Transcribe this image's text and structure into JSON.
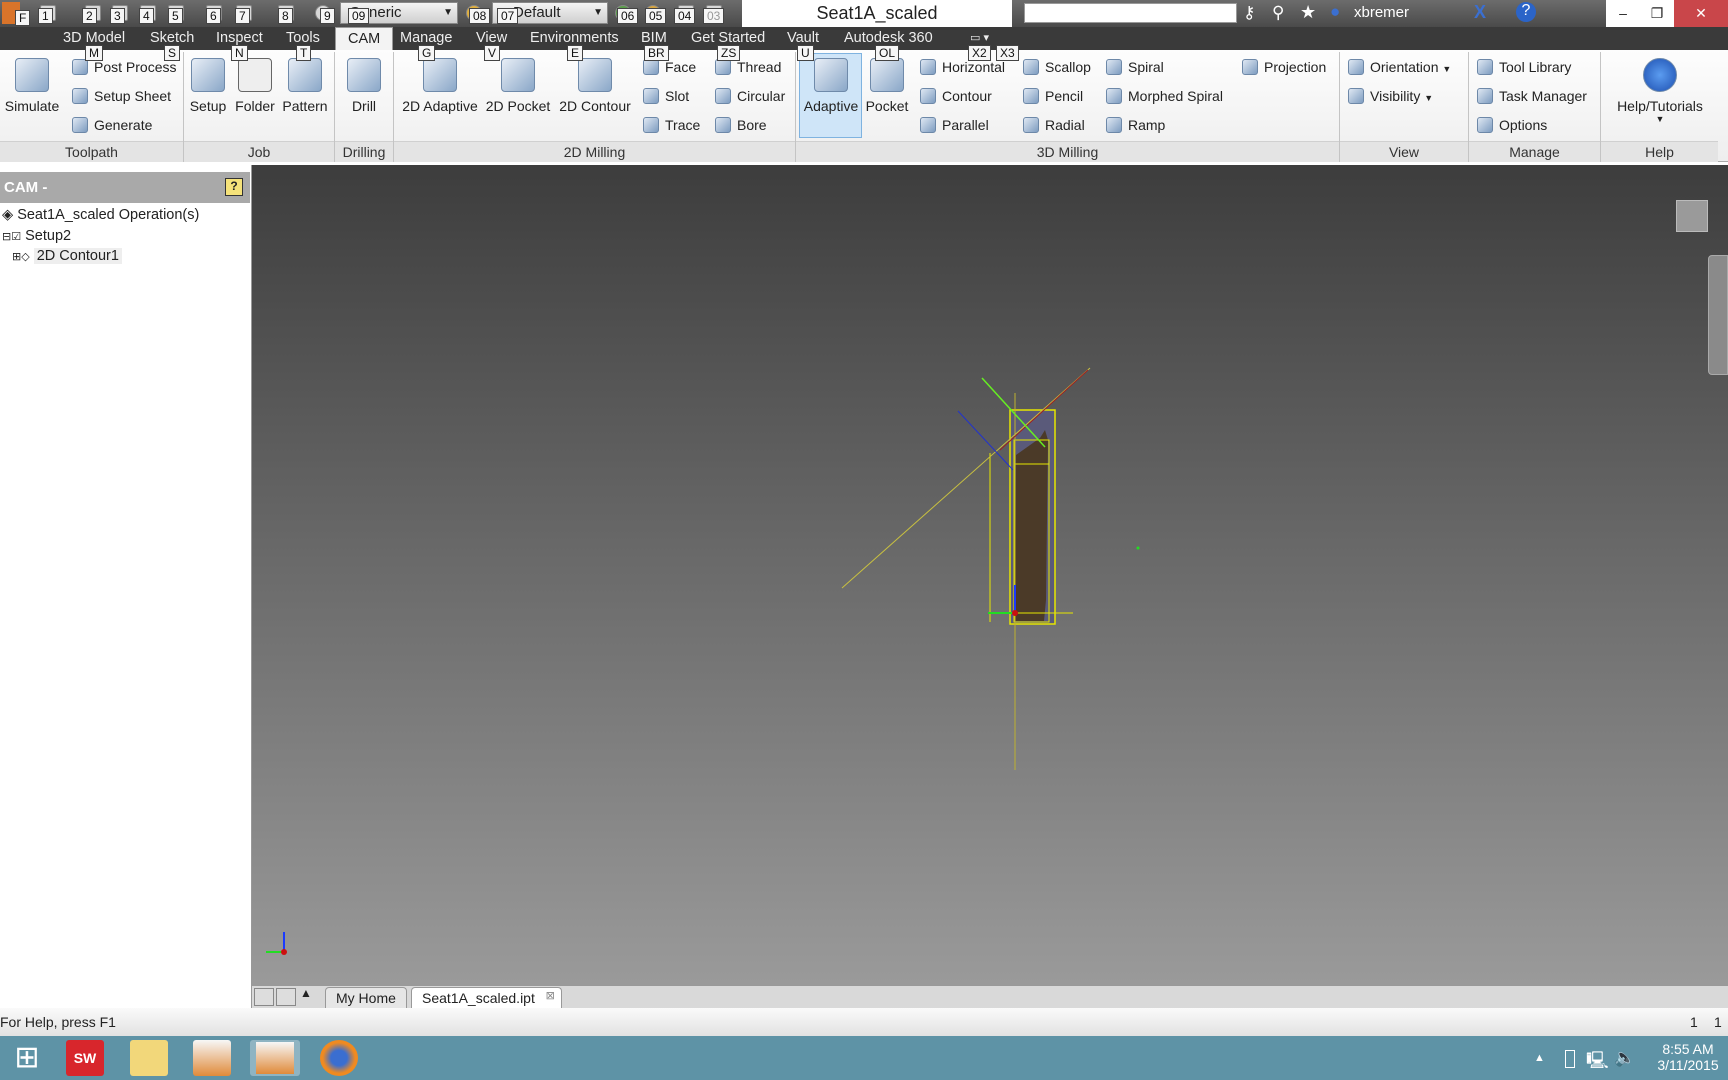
{
  "title_bar": {
    "document_title": "Seat1A_scaled",
    "material_dropdown": "Generic",
    "appearance_dropdown": "Default",
    "username": "xbremer",
    "search_placeholder": ""
  },
  "ribbon_tabs": [
    "3D Model",
    "Sketch",
    "Inspect",
    "Tools",
    "CAM",
    "Manage",
    "View",
    "Environments",
    "BIM",
    "Get Started",
    "Vault",
    "Autodesk 360"
  ],
  "active_tab": "CAM",
  "keytips": [
    "F",
    "1",
    "2",
    "3",
    "4",
    "5",
    "6",
    "7",
    "8",
    "9",
    "09",
    "08",
    "07",
    "06",
    "05",
    "04",
    "03",
    "M",
    "S",
    "N",
    "T",
    "G",
    "V",
    "E",
    "BR",
    "ZS",
    "U",
    "OL",
    "X2",
    "X3"
  ],
  "panels": {
    "toolpath": {
      "label": "Toolpath",
      "simulate": "Simulate",
      "post_process": "Post Process",
      "setup_sheet": "Setup Sheet",
      "generate": "Generate"
    },
    "job": {
      "label": "Job",
      "setup": "Setup",
      "folder": "Folder",
      "pattern": "Pattern"
    },
    "drilling": {
      "label": "Drilling",
      "drill": "Drill"
    },
    "milling2d": {
      "label": "2D Milling",
      "adaptive": "2D Adaptive",
      "pocket": "2D Pocket",
      "contour": "2D Contour",
      "face": "Face",
      "slot": "Slot",
      "trace": "Trace",
      "thread": "Thread",
      "circular": "Circular",
      "bore": "Bore"
    },
    "milling3d": {
      "label": "3D Milling",
      "adaptive": "Adaptive",
      "pocket": "Pocket",
      "horizontal": "Horizontal",
      "contour": "Contour",
      "parallel": "Parallel",
      "scallop": "Scallop",
      "pencil": "Pencil",
      "radial": "Radial",
      "spiral": "Spiral",
      "morphed_spiral": "Morphed Spiral",
      "ramp": "Ramp",
      "projection": "Projection"
    },
    "view": {
      "label": "View",
      "orientation": "Orientation",
      "visibility": "Visibility"
    },
    "manage": {
      "label": "Manage",
      "tool_library": "Tool Library",
      "task_manager": "Task Manager",
      "options": "Options"
    },
    "help": {
      "label": "Help",
      "help_tutorials": "Help/Tutorials"
    }
  },
  "browser": {
    "title": "CAM",
    "items": [
      "Seat1A_scaled Operation(s)",
      "Setup2",
      "2D Contour1"
    ]
  },
  "doc_tabs": [
    "My Home",
    "Seat1A_scaled.ipt"
  ],
  "status": {
    "help_text": "For Help, press F1",
    "count1": "1",
    "count2": "1"
  },
  "taskbar": {
    "time": "8:55 AM",
    "date": "3/11/2015",
    "apps": [
      "windows-start",
      "solidworks",
      "file-explorer",
      "fusion-360",
      "inventor-pro",
      "firefox"
    ]
  },
  "colors": {
    "accent": "#7fb3e0",
    "toolpath": "#ffff00",
    "stock": "#4b3a28",
    "taskbar": "#5e93a6"
  }
}
